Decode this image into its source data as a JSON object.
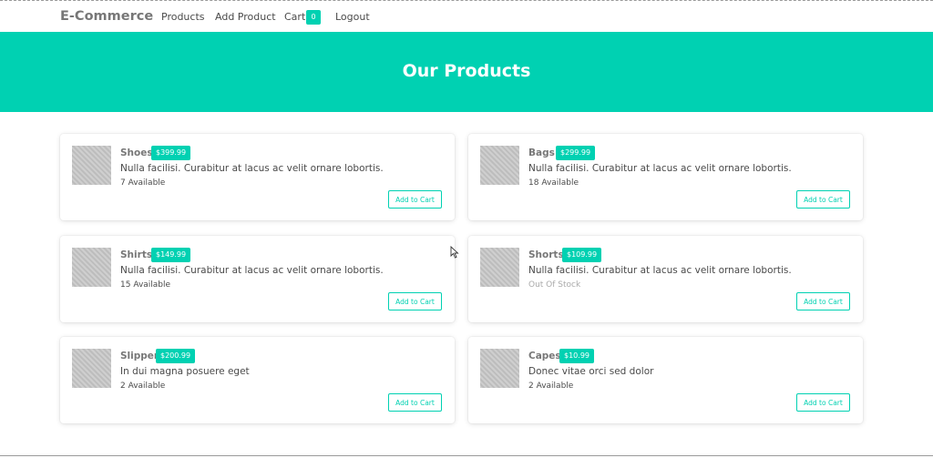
{
  "nav": {
    "brand": "E-Commerce",
    "links": [
      "Products",
      "Add Product",
      "Cart",
      "Logout"
    ],
    "cart_count": "0"
  },
  "hero": {
    "title": "Our Products"
  },
  "colors": {
    "accent": "#00d1b2",
    "text": "#4a4a4a",
    "muted": "#aaaaaa"
  },
  "products": [
    {
      "name": "Shoes",
      "price": "$399.99",
      "desc": "Nulla facilisi. Curabitur at lacus ac velit ornare lobortis.",
      "stock": "7 Available",
      "button": "Add to Cart"
    },
    {
      "name": "Bags",
      "price": "$299.99",
      "desc": "Nulla facilisi. Curabitur at lacus ac velit ornare lobortis.",
      "stock": "18 Available",
      "button": "Add to Cart"
    },
    {
      "name": "Shirts",
      "price": "$149.99",
      "desc": "Nulla facilisi. Curabitur at lacus ac velit ornare lobortis.",
      "stock": "15 Available",
      "button": "Add to Cart"
    },
    {
      "name": "Shorts",
      "price": "$109.99",
      "desc": "Nulla facilisi. Curabitur at lacus ac velit ornare lobortis.",
      "stock": "Out Of Stock",
      "button": "Add to Cart"
    },
    {
      "name": "Slipper",
      "price": "$200.99",
      "desc": "In dui magna posuere eget",
      "stock": "2 Available",
      "button": "Add to Cart"
    },
    {
      "name": "Capes",
      "price": "$10.99",
      "desc": "Donec vitae orci sed dolor",
      "stock": "2 Available",
      "button": "Add to Cart"
    }
  ]
}
